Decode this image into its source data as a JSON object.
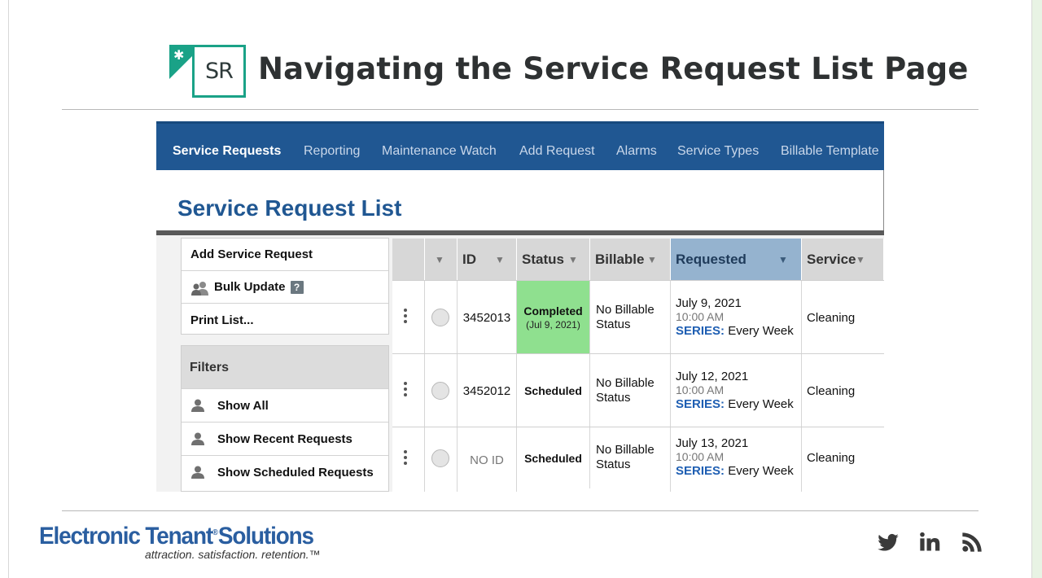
{
  "slide": {
    "logo_text": "SR",
    "title": "Navigating the Service Request List Page"
  },
  "nav": {
    "items": [
      {
        "label": "Service Requests",
        "active": true
      },
      {
        "label": "Reporting",
        "active": false
      },
      {
        "label": "Maintenance Watch",
        "active": false
      },
      {
        "label": "Add Request",
        "active": false
      },
      {
        "label": "Alarms",
        "active": false
      },
      {
        "label": "Service Types",
        "active": false
      },
      {
        "label": "Billable Template",
        "active": false
      }
    ]
  },
  "page": {
    "heading": "Service Request List"
  },
  "actions": {
    "add": "Add Service Request",
    "bulk": "Bulk Update",
    "bulk_help": "?",
    "print": "Print List..."
  },
  "filters": {
    "title": "Filters",
    "items": [
      "Show All",
      "Show Recent Requests",
      "Show Scheduled Requests"
    ]
  },
  "table": {
    "caret": "▼",
    "headers": {
      "id": "ID",
      "status": "Status",
      "billable": "Billable",
      "requested": "Requested",
      "service": "Service"
    },
    "rows": [
      {
        "id": "3452013",
        "status": "Completed",
        "status_sub": "(Jul 9, 2021)",
        "billable_1": "No Billable",
        "billable_2": "Status",
        "date": "July 9, 2021",
        "time": "10:00 AM",
        "series_label": "SERIES:",
        "series_value": "Every Week",
        "service": "Cleaning"
      },
      {
        "id": "3452012",
        "status": "Scheduled",
        "status_sub": "",
        "billable_1": "No Billable",
        "billable_2": "Status",
        "date": "July 12, 2021",
        "time": "10:00 AM",
        "series_label": "SERIES:",
        "series_value": "Every Week",
        "service": "Cleaning"
      },
      {
        "id": "NO ID",
        "status": "Scheduled",
        "status_sub": "",
        "billable_1": "No Billable",
        "billable_2": "Status",
        "date": "July 13, 2021",
        "time": "10:00 AM",
        "series_label": "SERIES:",
        "series_value": "Every Week",
        "service": "Cleaning"
      }
    ]
  },
  "footer": {
    "brand_1": "Electronic Tenant",
    "brand_reg": "®",
    "brand_2": "Solutions",
    "tagline": "attraction. satisfaction. retention.™",
    "social_icons": [
      "twitter-icon",
      "linkedin-icon",
      "rss-icon"
    ]
  },
  "colors": {
    "nav_bg": "#205792",
    "heading_blue": "#205792",
    "completed_green": "#8fe08f",
    "sorted_header": "#95b3cf",
    "series_blue": "#1f5fb3",
    "logo_teal": "#1aa287"
  }
}
